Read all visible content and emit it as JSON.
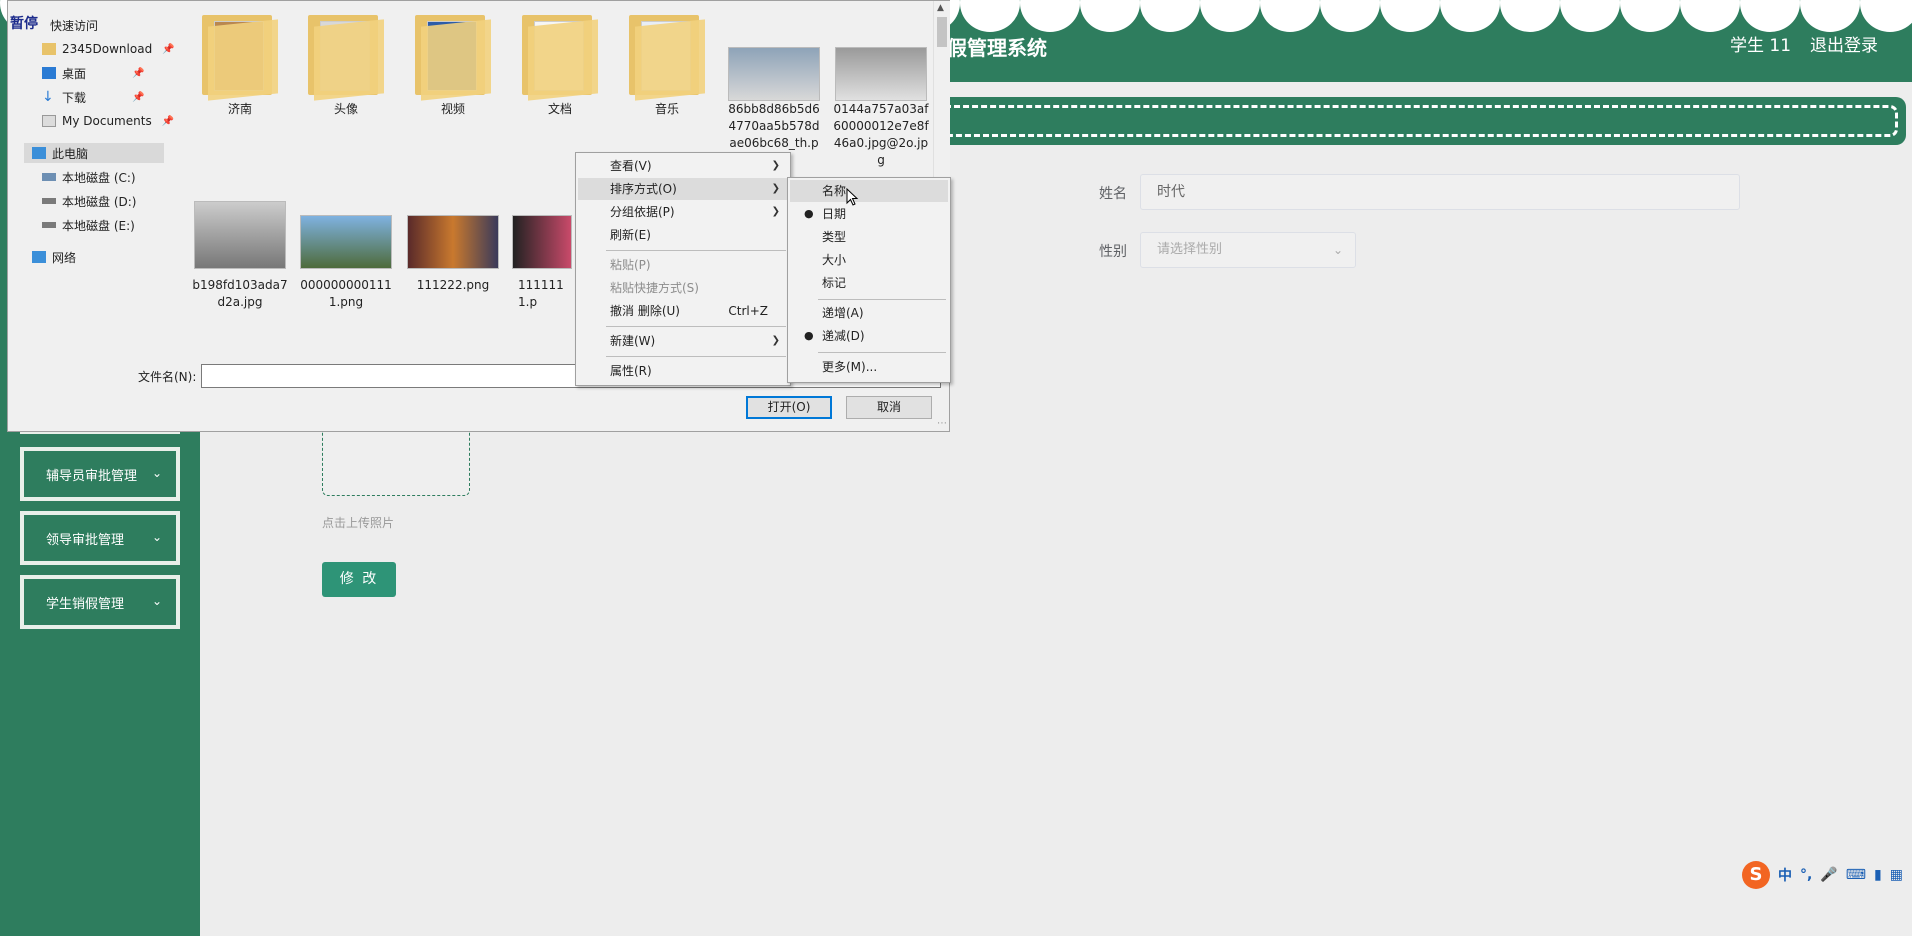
{
  "app": {
    "title_partial": "假管理系统",
    "user": "学生 11",
    "logout": "退出登录"
  },
  "sidebar": {
    "items": [
      {
        "label": "辅导员审批管理"
      },
      {
        "label": "领导审批管理"
      },
      {
        "label": "学生销假管理"
      }
    ]
  },
  "form": {
    "name_label": "姓名",
    "name_value": "时代",
    "gender_label": "性别",
    "gender_placeholder": "请选择性别",
    "upload_hint": "点击上传照片",
    "modify_button": "修 改"
  },
  "dialog": {
    "overlay_label": "暂停",
    "nav": {
      "quick_access": "快速访问",
      "items_pinned": [
        "2345Download",
        "桌面",
        "下载",
        "My Documents"
      ],
      "this_pc": "此电脑",
      "drives": [
        "本地磁盘 (C:)",
        "本地磁盘 (D:)",
        "本地磁盘 (E:)"
      ],
      "network": "网络"
    },
    "files": [
      {
        "name": "济南",
        "kind": "folder"
      },
      {
        "name": "头像",
        "kind": "folder"
      },
      {
        "name": "视频",
        "kind": "folder"
      },
      {
        "name": "文档",
        "kind": "folder"
      },
      {
        "name": "音乐",
        "kind": "folder"
      },
      {
        "name": "86bb8d86b5d64770aa5b578dae06bc68_th.pn",
        "kind": "image"
      },
      {
        "name": "0144a757a03af60000012e7e8f46a0.jpg@2o.jpg",
        "kind": "image"
      },
      {
        "name": "b198fd103ada7d2a.jpg",
        "kind": "image"
      },
      {
        "name": "0000000001111.png",
        "kind": "image"
      },
      {
        "name": "111222.png",
        "kind": "image"
      },
      {
        "name": "1111111.p",
        "kind": "image"
      }
    ],
    "filename_label": "文件名(N):",
    "filename_value": "",
    "open_button": "打开(O)",
    "cancel_button": "取消"
  },
  "context_menu": {
    "items": [
      {
        "label": "查看(V)",
        "submenu": true
      },
      {
        "label": "排序方式(O)",
        "submenu": true
      },
      {
        "label": "分组依据(P)",
        "submenu": true
      },
      {
        "label": "刷新(E)"
      },
      {
        "label": "粘贴(P)",
        "disabled": true
      },
      {
        "label": "粘贴快捷方式(S)",
        "disabled": true
      },
      {
        "label": "撤消 删除(U)",
        "shortcut": "Ctrl+Z"
      },
      {
        "label": "新建(W)",
        "submenu": true
      },
      {
        "label": "属性(R)"
      }
    ]
  },
  "sort_menu": {
    "items": [
      {
        "label": "名称"
      },
      {
        "label": "日期",
        "checked": true
      },
      {
        "label": "类型"
      },
      {
        "label": "大小"
      },
      {
        "label": "标记"
      },
      {
        "label": "递增(A)"
      },
      {
        "label": "递减(D)",
        "checked": true
      },
      {
        "label": "更多(M)..."
      }
    ]
  },
  "ime": {
    "logo": "S",
    "mode": "中",
    "punct": "°,"
  },
  "colors": {
    "brand_green": "#2e7d5e",
    "button_green": "#2e9477",
    "dialog_bg": "#f0f0f0",
    "focus_blue": "#0078d7"
  }
}
